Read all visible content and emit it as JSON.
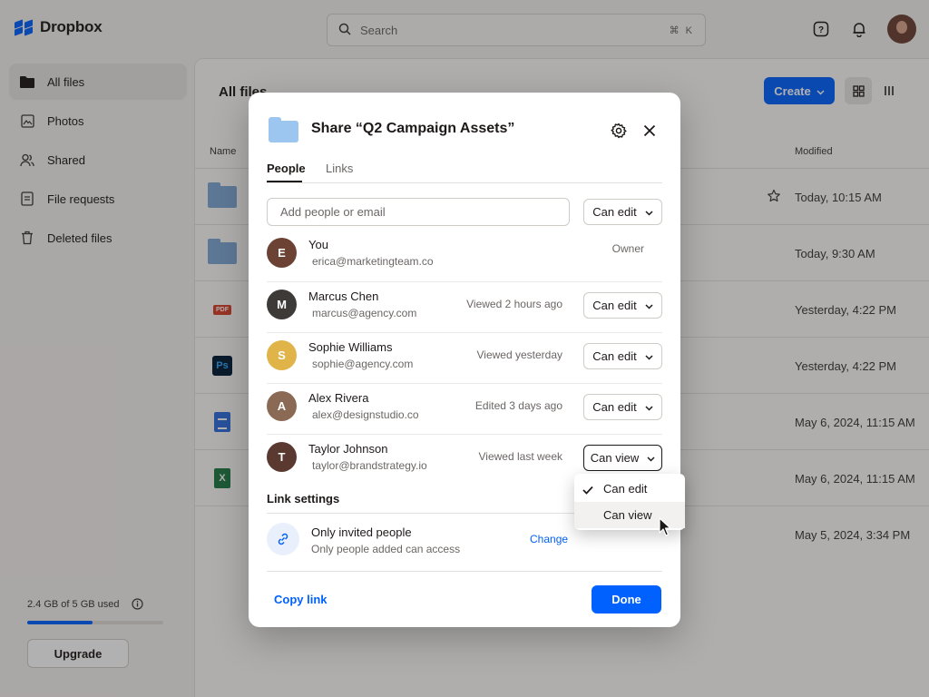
{
  "app": {
    "logo_text": "Dropbox",
    "search_placeholder": "Search",
    "search_shortcut": "⌘ K",
    "accent_color": "#0061fe"
  },
  "sidebar": {
    "items": [
      {
        "label": "All files",
        "icon": "folder-icon"
      },
      {
        "label": "Photos",
        "icon": "photo-icon"
      },
      {
        "label": "Shared",
        "icon": "people-icon"
      },
      {
        "label": "File requests",
        "icon": "file-request-icon"
      },
      {
        "label": "Deleted files",
        "icon": "trash-icon"
      }
    ],
    "storage_text": "2.4 GB of 5 GB used",
    "storage_used_fraction": 0.48,
    "upgrade_label": "Upgrade"
  },
  "main": {
    "title": "All files",
    "create_label": "Create",
    "col_name": "Name",
    "col_modified": "Modified",
    "rows": [
      {
        "type": "folder",
        "modified": "Today, 10:15 AM",
        "starred": true
      },
      {
        "type": "folder",
        "modified": "Today, 9:30 AM"
      },
      {
        "type": "pdf",
        "modified": "Yesterday, 4:22 PM"
      },
      {
        "type": "psd",
        "modified": "Yesterday, 4:22 PM"
      },
      {
        "type": "doc",
        "modified": "May 6, 2024, 11:15 AM"
      },
      {
        "type": "xls",
        "modified": "May 6, 2024, 11:15 AM"
      },
      {
        "type": "other",
        "modified": "May 5, 2024, 3:34 PM"
      }
    ]
  },
  "modal": {
    "title": "Share “Q2 Campaign Assets”",
    "tabs": [
      "People",
      "Links"
    ],
    "add_placeholder": "Add people or email",
    "add_permission": "Can edit",
    "people": [
      {
        "name": "You",
        "email": "erica@marketingteam.co",
        "role": "Owner",
        "initial": "E",
        "color": "#6b4234"
      },
      {
        "name": "Marcus Chen",
        "email": "marcus@agency.com",
        "activity": "Viewed 2 hours ago",
        "permission": "Can edit",
        "initial": "M",
        "color": "#3d3a38"
      },
      {
        "name": "Sophie Williams",
        "email": "sophie@agency.com",
        "activity": "Viewed yesterday",
        "permission": "Can edit",
        "initial": "S",
        "color": "#e0b449"
      },
      {
        "name": "Alex Rivera",
        "email": "alex@designstudio.co",
        "activity": "Edited 3 days ago",
        "permission": "Can edit",
        "initial": "A",
        "color": "#8a6a55"
      },
      {
        "name": "Taylor Johnson",
        "email": "taylor@brandstrategy.io",
        "activity": "Viewed last week",
        "permission": "Can view",
        "initial": "T",
        "color": "#5a3a30"
      }
    ],
    "link_settings_title": "Link settings",
    "link_access_title": "Only invited people",
    "link_access_sub": "Only people added can access",
    "change_label": "Change",
    "copy_link_label": "Copy link",
    "done_label": "Done"
  },
  "dropdown": {
    "options": [
      {
        "label": "Can edit",
        "checked": true
      },
      {
        "label": "Can view",
        "hovered": true
      }
    ]
  }
}
